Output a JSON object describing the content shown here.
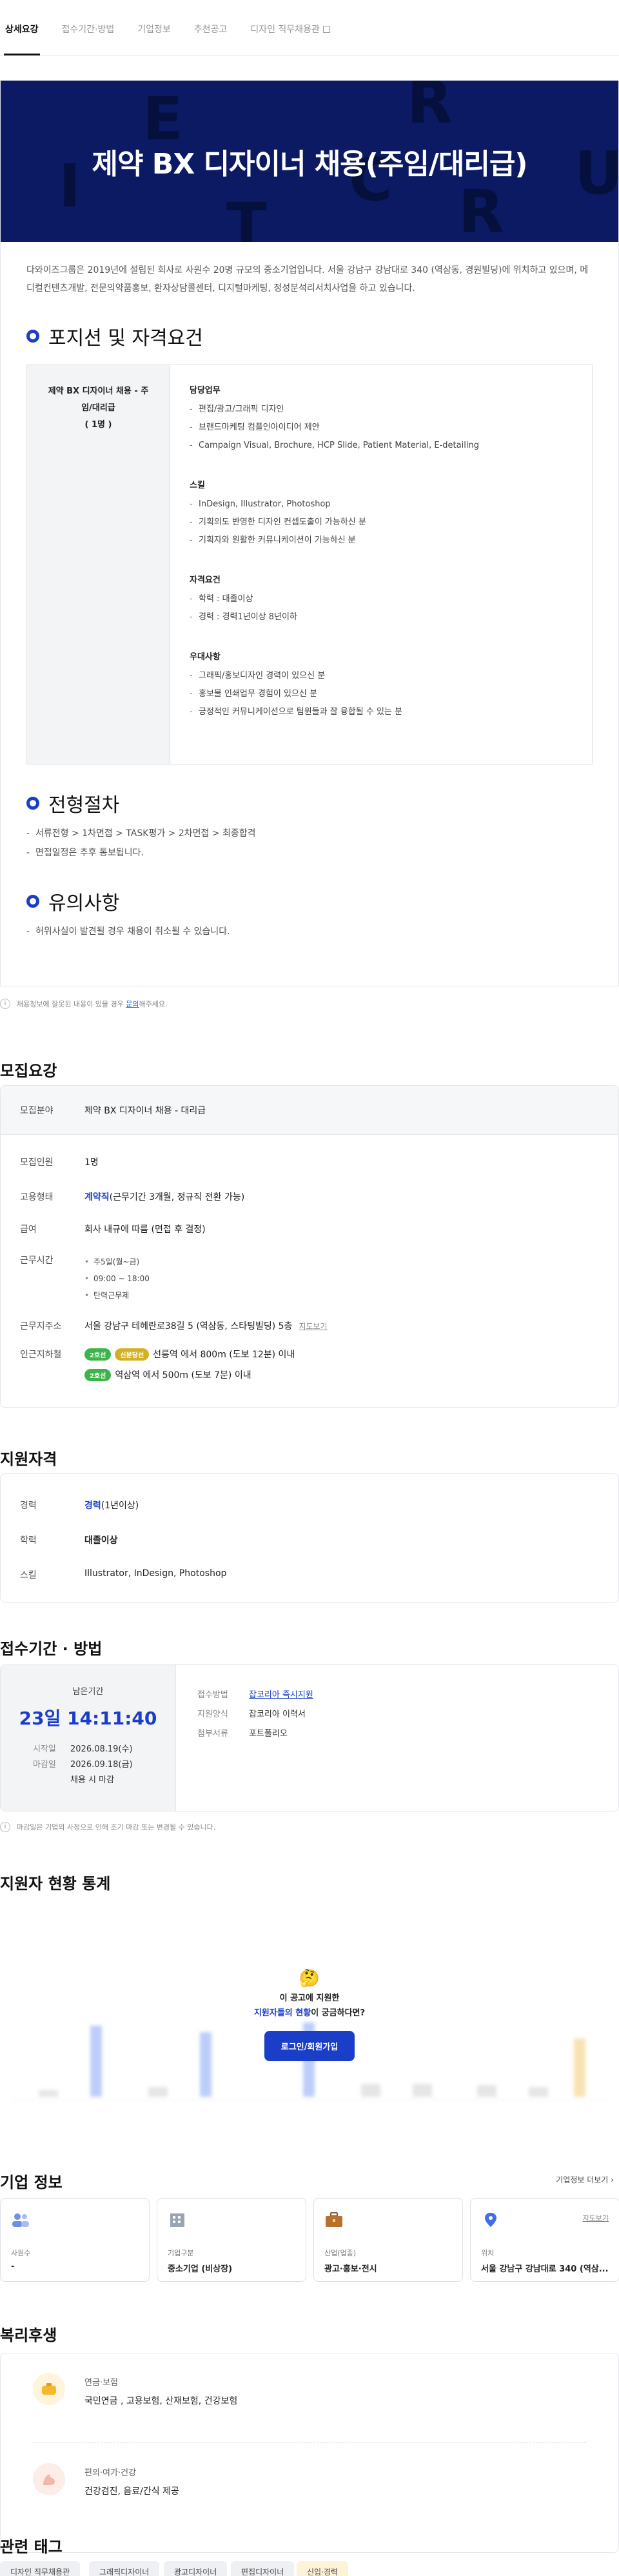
{
  "tabs": [
    {
      "label": "상세요강"
    },
    {
      "label": "접수기간·방법"
    },
    {
      "label": "기업정보"
    },
    {
      "label": "추천공고"
    },
    {
      "label": "디자인 직무채용관"
    }
  ],
  "hero": {
    "title": "제약 BX 디자이너 채용(주임/대리급)",
    "letters": [
      "E",
      "R",
      "C",
      "U",
      "I",
      "R",
      "T"
    ]
  },
  "intro": "다와이즈그룹은 2019년에 설립된 회사로 사원수 20명 규모의 중소기업입니다. 서울 강남구 강남대로 340 (역삼동, 경원빌딩)에 위치하고 있으며, 메디컬컨텐츠개발, 전문의약품홍보, 환자상담콜센터, 디지털마케팅, 정성분석리서치사업을 하고 있습니다.",
  "position": {
    "title": "포지션 및 자격요건",
    "left_title": "제약 BX 디자이너 채용 - 주임/대리급",
    "left_count": "( 1명 )",
    "groups": [
      {
        "heading": "담당업무",
        "items": [
          "편집/광고/그래픽 디자인",
          "브랜드마케팅 컴플인아이디어 제안",
          "Campaign Visual, Brochure, HCP Slide, Patient Material, E-detailing"
        ]
      },
      {
        "heading": "스킬",
        "items": [
          "InDesign, Illustrator, Photoshop",
          "기획의도 반영한 디자인 컨셉도출이 가능하신 분",
          "기획자와 원활한 커뮤니케이션이 가능하신 분"
        ]
      },
      {
        "heading": "자격요건",
        "items": [
          "학력 : 대졸이상",
          "경력 : 경력1년이상 8년이하"
        ]
      },
      {
        "heading": "우대사항",
        "items": [
          "그래픽/홍보디자인 경력이 있으신 분",
          "홍보물 인쇄업무 경험이 있으신 분",
          "긍정적인 커뮤니케이션으로 팀원들과 잘 융합될 수 있는 분"
        ]
      }
    ]
  },
  "process": {
    "title": "전형절차",
    "lines": [
      "서류전형 > 1차면접 > TASK평가 > 2차면접 > 최종합격",
      "면접일정은 추후 통보됩니다."
    ]
  },
  "caution": {
    "title": "유의사항",
    "lines": [
      "허위사실이 발견될 경우 채용이 취소될 수 있습니다."
    ]
  },
  "notice": {
    "text": "채용정보에 잘못된 내용이 있을 경우",
    "link": "문의",
    "tail": "해주세요."
  },
  "recruit": {
    "title": "모집요강",
    "field_label": "모집분야",
    "field_value": "제약 BX 디자이너 채용 - 대리급",
    "count_label": "모집인원",
    "count_value": "1명",
    "type_label": "고용형태",
    "type_blue": "계약직",
    "type_rest": "(근무기간 3개월, 정규직 전환 가능)",
    "pay_label": "급여",
    "pay_value": "회사 내규에 따름 (면접 후 결정)",
    "time_label": "근무시간",
    "time_items": [
      "주5일(월~금)",
      "09:00 ~ 18:00",
      "탄력근무제"
    ],
    "addr_label": "근무지주소",
    "addr_value": "서울 강남구 테헤란로38길 5 (역삼동, 스타팅빌딩) 5층",
    "map_label": "지도보기",
    "subway_label": "인근지하철",
    "subway": [
      {
        "line": "2호선",
        "line2": "신분당선",
        "text": "선릉역 에서 800m (도보 12분) 이내"
      },
      {
        "line": "2호선",
        "text": "역삼역 에서 500m (도보 7분) 이내"
      }
    ]
  },
  "qualify": {
    "title": "지원자격",
    "exp_label": "경력",
    "exp_blue": "경력",
    "exp_rest": "(1년이상)",
    "edu_label": "학력",
    "edu_value": "대졸이상",
    "skill_label": "스킬",
    "skill_value": "Illustrator, InDesign, Photoshop"
  },
  "period": {
    "title": "접수기간 · 방법",
    "remain_label": "남은기간",
    "remain_value": "23일 14:11:40",
    "start_label": "시작일",
    "start_value": "2026.08.19(수)",
    "end_label": "마감일",
    "end_value": "2026.09.18(금)",
    "close_note": "채용 시 마감",
    "method_label": "접수방법",
    "method_value": "잡코리아 즉시지원",
    "form_label": "지원양식",
    "form_value": "잡코리아 이력서",
    "doc_label": "첨부서류",
    "doc_value": "포트폴리오",
    "footnote": "마감일은 기업의 사정으로 인해 조기 마감 또는 변경될 수 있습니다."
  },
  "stats": {
    "title": "지원자 현황 통계",
    "prompt_line1": "이 공고에 지원한",
    "prompt_blue": "지원자들의 현황",
    "prompt_line2": "이 궁금하다면?",
    "button": "로그인/회원가입"
  },
  "company": {
    "title": "기업 정보",
    "more": "기업정보 더보기",
    "cards": [
      {
        "key": "사원수",
        "value": "-"
      },
      {
        "key": "기업구분",
        "value": "중소기업 (비상장)"
      },
      {
        "key": "산업(업종)",
        "value": "광고·홍보·전시"
      },
      {
        "key": "위치",
        "value": "서울 강남구 강남대로 340 (역삼...",
        "map": "지도보기"
      }
    ]
  },
  "welfare": {
    "title": "복리후생",
    "items": [
      {
        "key": "연금·보험",
        "value": "국민연금 , 고용보험, 산재보험, 건강보험"
      },
      {
        "key": "편의·여가·건강",
        "value": "건강검진, 음료/간식 제공"
      }
    ]
  },
  "tags": {
    "title": "관련 태그",
    "items": [
      "디자인 직무채용관",
      "그래픽디자이너",
      "광고디자이너",
      "편집디자이너",
      "신입·경력"
    ]
  },
  "colors": {
    "accent": "#1a3ec8",
    "hero_bg": "#0b1a63",
    "subway_green": "#3cb44a",
    "subway_yellow": "#d4b020"
  }
}
